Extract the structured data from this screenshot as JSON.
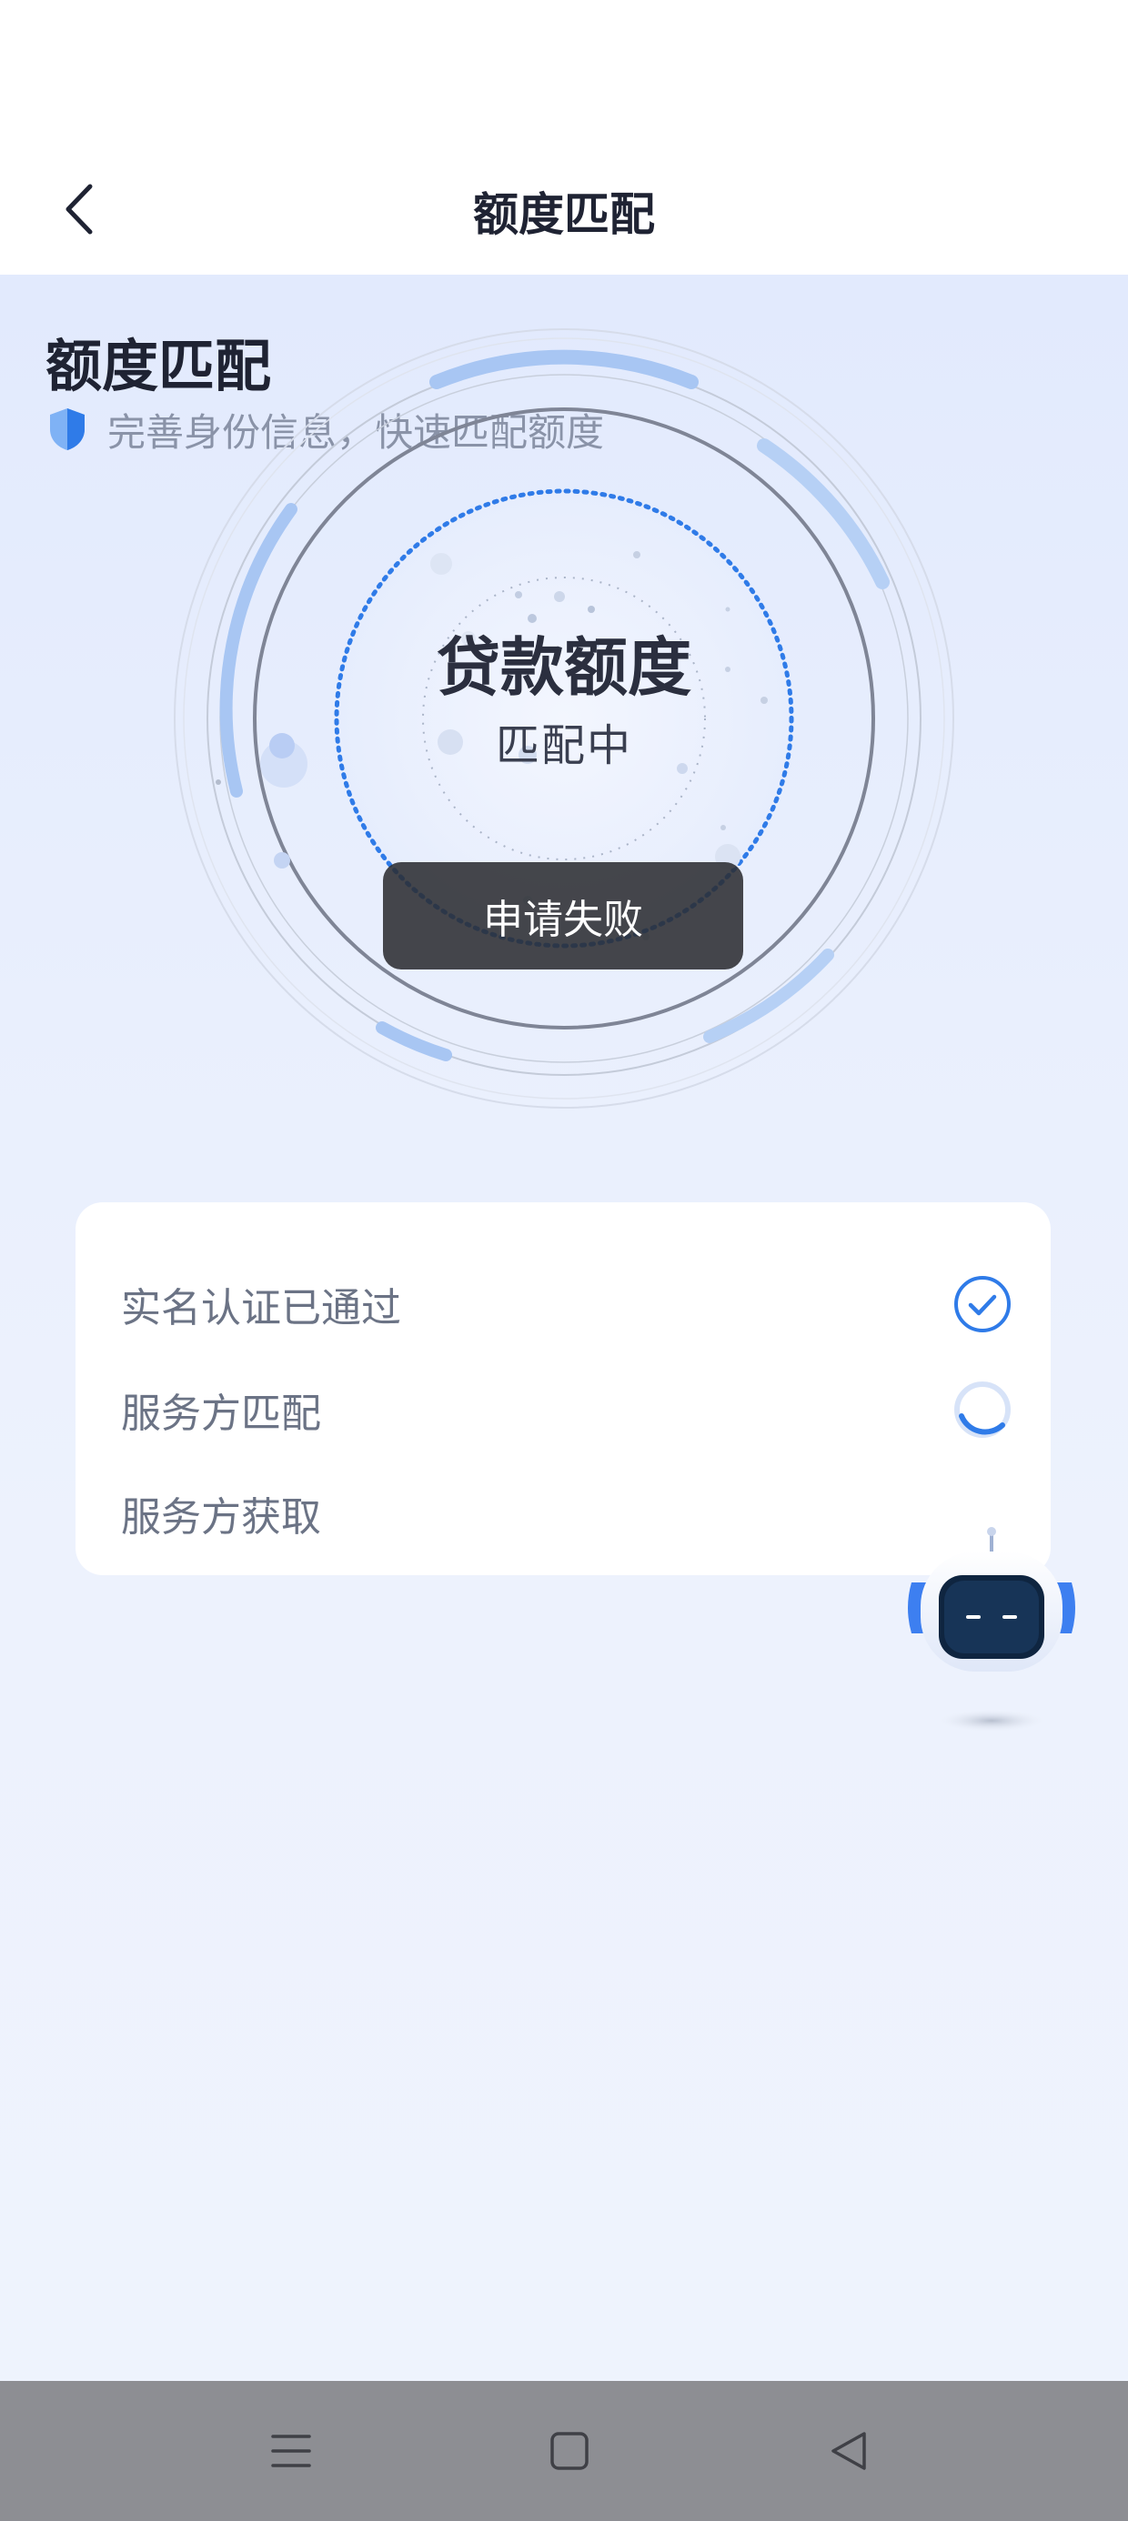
{
  "header": {
    "title": "额度匹配",
    "back_icon": "chevron-left-icon"
  },
  "intro": {
    "heading": "额度匹配",
    "subtitle": "完善身份信息，快速匹配额度",
    "subtitle_icon": "shield-icon"
  },
  "radar": {
    "title": "贷款额度",
    "status": "匹配中"
  },
  "toast": {
    "message": "申请失败"
  },
  "steps": [
    {
      "label": "实名认证已通过",
      "state": "done",
      "icon": "check-circle-icon"
    },
    {
      "label": "服务方匹配",
      "state": "loading",
      "icon": "spinner-icon"
    },
    {
      "label": "服务方获取",
      "state": "pending"
    }
  ],
  "assistant": {
    "icon": "robot-icon"
  },
  "system_nav": {
    "menu_icon": "menu-icon",
    "home_icon": "home-square-icon",
    "back_icon": "back-triangle-icon"
  },
  "colors": {
    "accent": "#2f7be8",
    "title": "#1f2333",
    "muted": "#8a93a8",
    "background": "#e8eefd",
    "toast_bg": "#2c2d32",
    "navbar": "#8d8e93"
  }
}
